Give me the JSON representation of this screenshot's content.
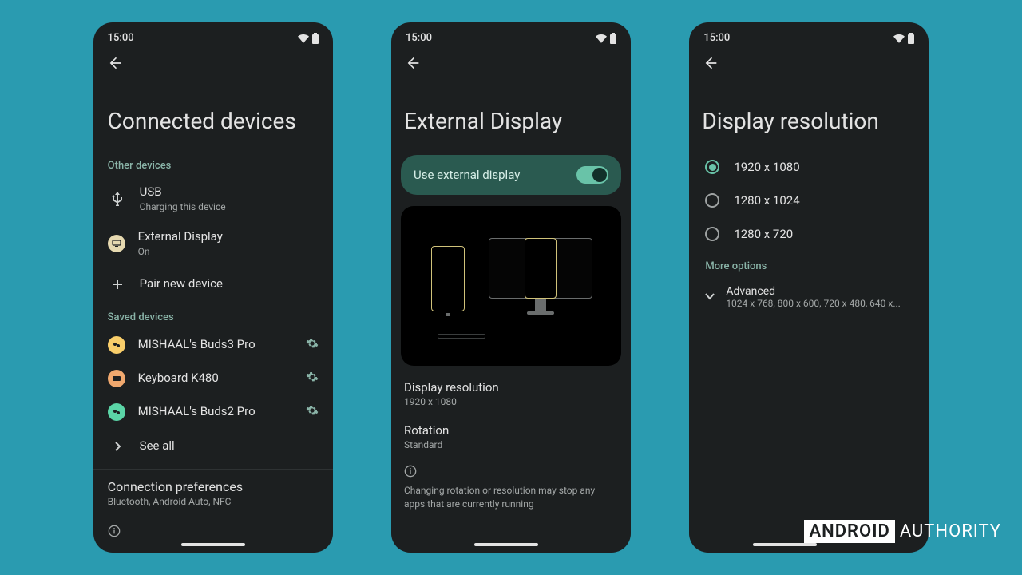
{
  "status": {
    "time": "15:00"
  },
  "screen1": {
    "title": "Connected devices",
    "section_other": "Other devices",
    "usb": {
      "title": "USB",
      "sub": "Charging this device"
    },
    "extdisp": {
      "title": "External Display",
      "sub": "On"
    },
    "pair": {
      "title": "Pair new device"
    },
    "section_saved": "Saved devices",
    "dev1": {
      "title": "MISHAAL's Buds3 Pro"
    },
    "dev2": {
      "title": "Keyboard K480"
    },
    "dev3": {
      "title": "MISHAAL's Buds2 Pro"
    },
    "see_all": "See all",
    "conn_pref": {
      "title": "Connection preferences",
      "sub": "Bluetooth, Android Auto, NFC"
    }
  },
  "screen2": {
    "title": "External Display",
    "toggle_label": "Use external display",
    "res": {
      "title": "Display resolution",
      "sub": "1920 x 1080"
    },
    "rot": {
      "title": "Rotation",
      "sub": "Standard"
    },
    "info": "Changing rotation or resolution may stop any apps that are currently running"
  },
  "screen3": {
    "title": "Display resolution",
    "opt1": "1920 x 1080",
    "opt2": "1280 x 1024",
    "opt3": "1280 x 720",
    "more": "More options",
    "adv": {
      "title": "Advanced",
      "sub": "1024 x 768, 800 x 600, 720 x 480, 640 x..."
    }
  },
  "watermark": {
    "bold": "ANDROID",
    "light": "AUTHORITY"
  }
}
